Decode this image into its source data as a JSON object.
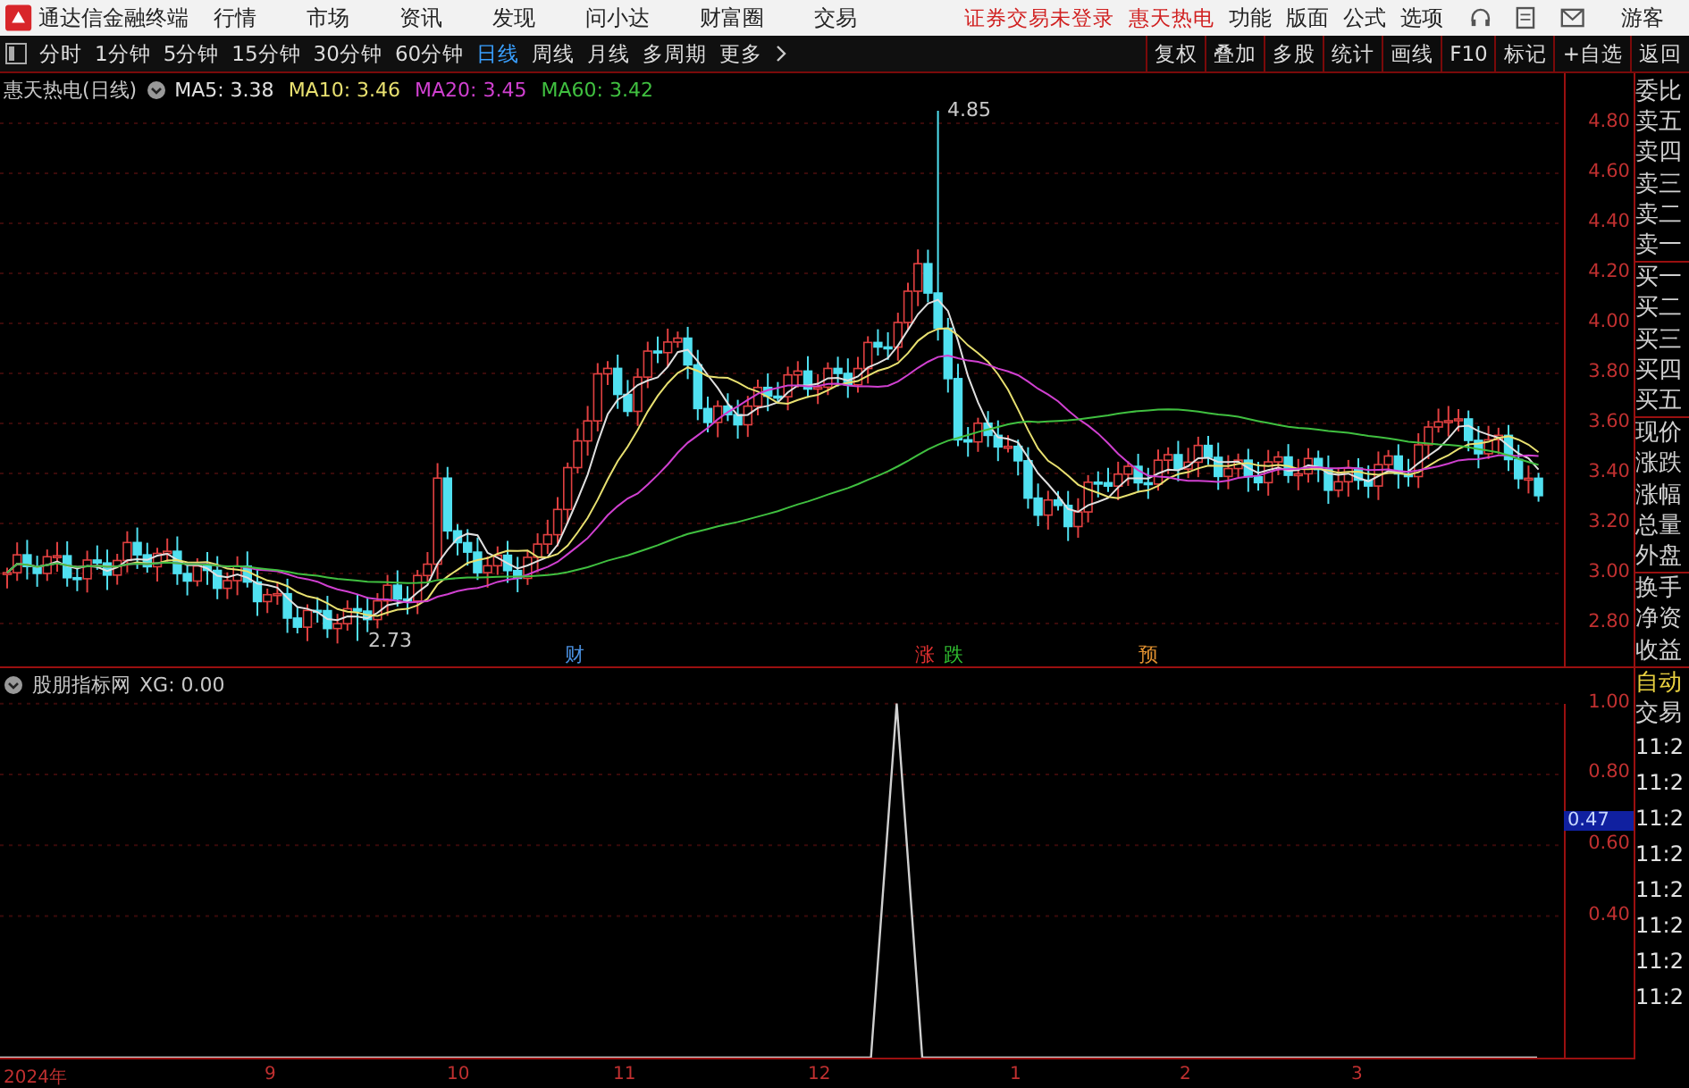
{
  "app": {
    "title": "通达信金融终端",
    "menu": [
      "行情",
      "市场",
      "资讯",
      "发现",
      "问小达",
      "财富圈",
      "交易"
    ],
    "notice": "证券交易未登录",
    "stock_name": "惠天热电",
    "tools": [
      "功能",
      "版面",
      "公式",
      "选项"
    ],
    "user": "游客"
  },
  "periods": [
    {
      "label": "分时",
      "selected": false
    },
    {
      "label": "1分钟",
      "selected": false
    },
    {
      "label": "5分钟",
      "selected": false
    },
    {
      "label": "15分钟",
      "selected": false
    },
    {
      "label": "30分钟",
      "selected": false
    },
    {
      "label": "60分钟",
      "selected": false
    },
    {
      "label": "日线",
      "selected": true
    },
    {
      "label": "周线",
      "selected": false
    },
    {
      "label": "月线",
      "selected": false
    },
    {
      "label": "多周期",
      "selected": false
    },
    {
      "label": "更多",
      "selected": false
    }
  ],
  "chart_tools": [
    "复权",
    "叠加",
    "多股",
    "统计",
    "画线",
    "F10",
    "标记",
    "+自选",
    "返回"
  ],
  "main_chart": {
    "title": "惠天热电(日线)",
    "indicators": [
      {
        "label": "MA5: 3.38",
        "color": "#e0e0e0"
      },
      {
        "label": "MA10: 3.46",
        "color": "#e8e070"
      },
      {
        "label": "MA20: 3.45",
        "color": "#d040d0"
      },
      {
        "label": "MA60: 3.42",
        "color": "#40c040"
      }
    ],
    "high_label": "4.85",
    "low_label": "2.73",
    "price_axis": [
      "4.80",
      "4.60",
      "4.40",
      "4.20",
      "4.00",
      "3.80",
      "3.60",
      "3.40",
      "3.20",
      "3.00",
      "2.80"
    ],
    "events": [
      {
        "label": "财",
        "color": "#4a90e0"
      },
      {
        "label": "涨",
        "color": "#e03030"
      },
      {
        "label": "跌",
        "color": "#30c030"
      },
      {
        "label": "预",
        "color": "#e09030"
      }
    ]
  },
  "indicator_panel": {
    "title": "股朋指标网",
    "reading": ": 0.00",
    "cursor_value": "0.47",
    "chart_data": {
      "type": "line",
      "grid": true,
      "ylim": [
        0,
        1
      ],
      "yticks": [
        {
          "value": 1,
          "label": "1.00"
        },
        {
          "value": 0.8,
          "label": "0.80"
        },
        {
          "value": 0.6,
          "label": "0.60"
        },
        {
          "value": 0.4,
          "label": "0.40"
        }
      ],
      "series": [
        {
          "name": "XG",
          "color": "#d0d0d0",
          "values": [
            0,
            0,
            0,
            0,
            0,
            0,
            0,
            0,
            0,
            0,
            0,
            0,
            0,
            0,
            0,
            0,
            0,
            0,
            0,
            0,
            0,
            0,
            0,
            0,
            0,
            0,
            0,
            0,
            0,
            0,
            0,
            0,
            0,
            0,
            0,
            1,
            0,
            0,
            0,
            0,
            0,
            0,
            0,
            0,
            0,
            0,
            0,
            0,
            0,
            0,
            0,
            0,
            0,
            0,
            0,
            0,
            0,
            0,
            0,
            0,
            0
          ]
        }
      ]
    }
  },
  "quote_panel": {
    "groups": [
      [
        "委比",
        "卖五",
        "卖四",
        "卖三",
        "卖二",
        "卖一"
      ],
      [
        "买一",
        "买二",
        "买三",
        "买四",
        "买五"
      ],
      [
        "现价",
        "涨跌",
        "涨幅",
        "总量",
        "外盘"
      ],
      [
        "换手",
        "净资",
        "收益"
      ]
    ],
    "auto_label": "自动",
    "trade_label": "交易",
    "times": [
      "11:2",
      "11:2",
      "11:2",
      "11:2",
      "11:2",
      "11:2",
      "11:2",
      "11:2"
    ]
  },
  "time_axis": [
    "2024年",
    "9",
    "10",
    "11",
    "12",
    "1",
    "2",
    "3"
  ]
}
